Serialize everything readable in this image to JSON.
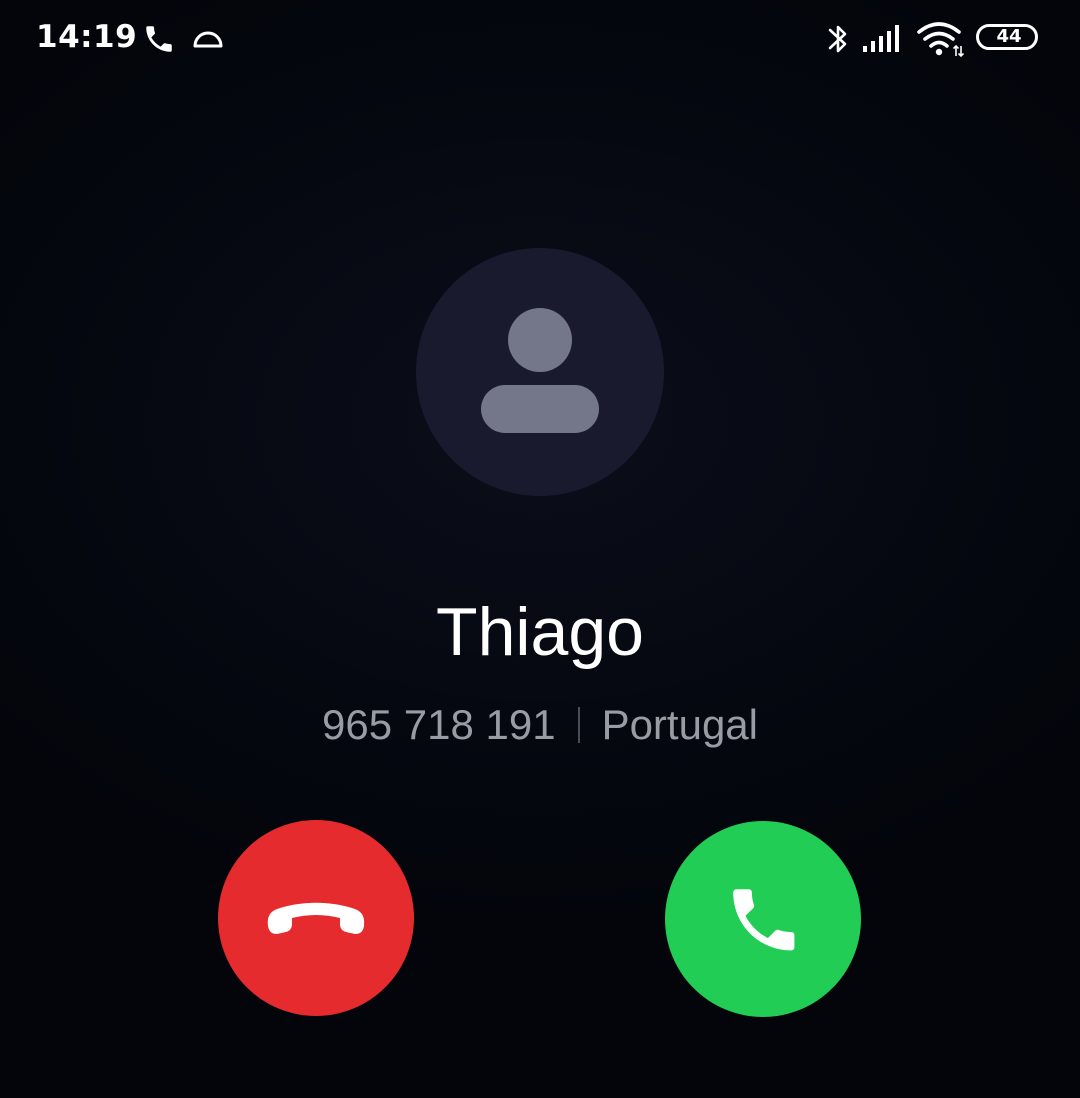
{
  "status_bar": {
    "time": "14:19",
    "left_icons": [
      "phone-icon",
      "half-circle-icon"
    ],
    "right_icons": [
      "bluetooth-icon",
      "signal-icon",
      "wifi-icon",
      "battery-icon"
    ],
    "battery_level": "44"
  },
  "caller": {
    "avatar_icon": "person-icon",
    "name": "Thiago",
    "number": "965 718 191",
    "location": "Portugal"
  },
  "actions": {
    "decline_icon": "hang-up-icon",
    "accept_icon": "phone-icon"
  },
  "colors": {
    "decline": "#e52b2e",
    "accept": "#22cd55",
    "avatar_bg": "#191a2d",
    "avatar_fg": "#747789",
    "secondary_text": "#9a9ca4"
  }
}
